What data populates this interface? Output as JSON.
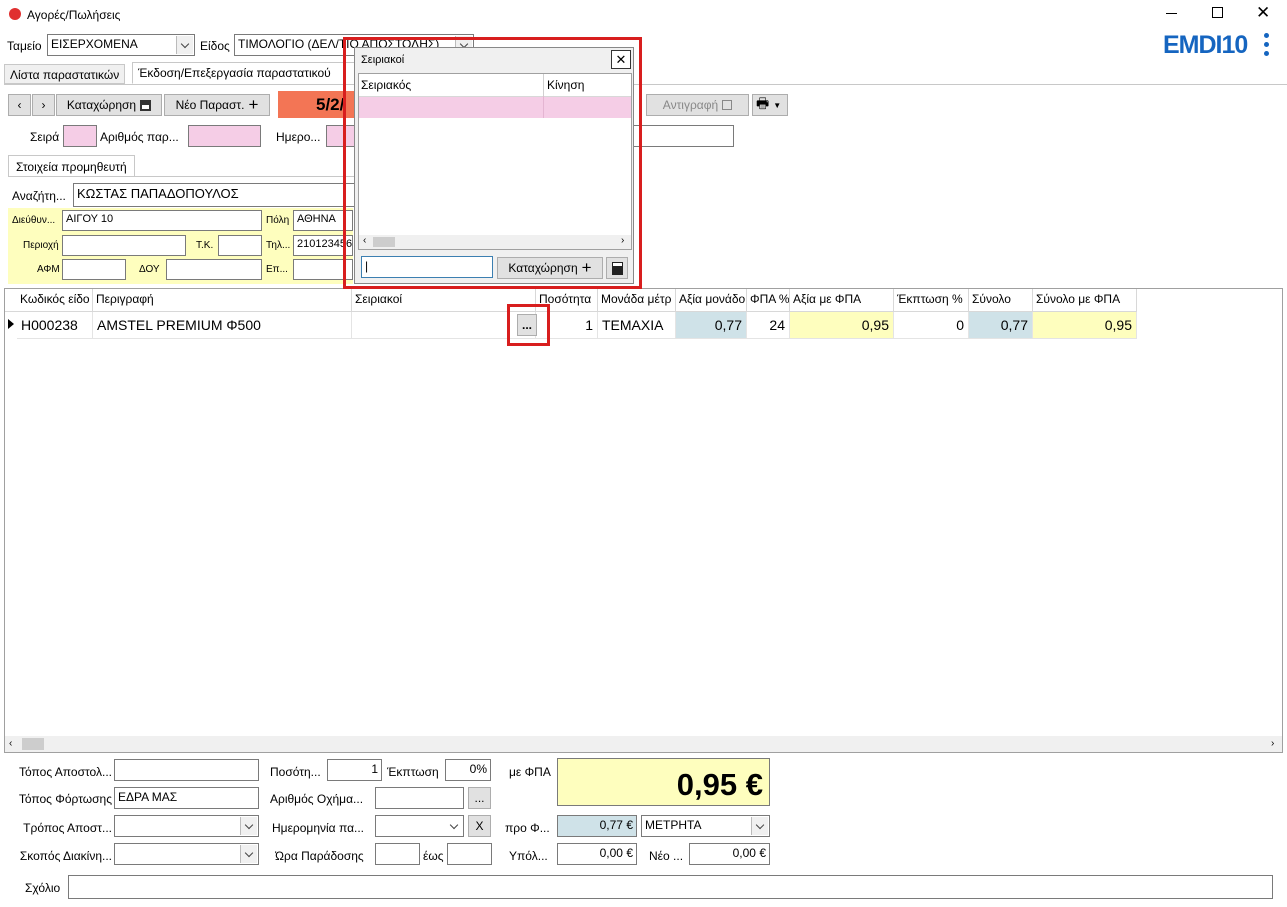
{
  "window": {
    "title": "Αγορές/Πωλήσεις",
    "brand": "EMDI10"
  },
  "top": {
    "tameio_label": "Ταμείο",
    "tameio_value": "ΕΙΣΕΡΧΟΜΕΝΑ",
    "eidos_label": "Είδος",
    "eidos_value": "ΤΙΜΟΛΟΓΙΟ (ΔΕΛ/ΤΙΟ ΑΠΟΣΤΟΛΗΣ)"
  },
  "tabs": [
    "Λίστα παραστατικών",
    "Έκδοση/Επεξεργασία παραστατικού"
  ],
  "toolbar": {
    "save_label": "Καταχώρηση",
    "new_label": "Νέο Παραστ.",
    "date_value": "5/2/",
    "copy_label": "Αντιγραφή"
  },
  "series": {
    "seira_label": "Σειρά",
    "arithmos_label": "Αριθμός παρ...",
    "date_label": "Ημερο..."
  },
  "supplier": {
    "tab_label": "Στοιχεία προμηθευτή",
    "search_label": "Αναζήτη...",
    "search_value": "ΚΩΣΤΑΣ ΠΑΠΑΔΟΠΟΥΛΟΣ",
    "address_label": "Διεύθυν...",
    "address_value": "ΑΙΓΟΥ 10",
    "city_label": "Πόλη",
    "city_value": "ΑΘΗΝΑ",
    "area_label": "Περιοχή",
    "tk_label": "Τ.Κ.",
    "phone_label": "Τηλ...",
    "phone_value": "2101234567",
    "afm_label": "ΑΦΜ",
    "doy_label": "ΔΟΥ",
    "ep_label": "Επ..."
  },
  "grid": {
    "headers": [
      "Κωδικός είδο",
      "Περιγραφή",
      "Σειριακοί",
      "Ποσότητα",
      "Μονάδα μέτρ",
      "Αξία μονάδο",
      "ΦΠΑ %",
      "Αξία με ΦΠΑ",
      "Έκπτωση %",
      "Σύνολο",
      "Σύνολο με ΦΠΑ"
    ],
    "row": {
      "code": "H000238",
      "desc": "AMSTEL PREMIUM Φ500",
      "serial_btn": "...",
      "qty": "1",
      "unit": "ΤΕΜΑΧΙΑ",
      "unit_price": "0,77",
      "vat": "24",
      "price_vat": "0,95",
      "discount": "0",
      "total": "0,77",
      "total_vat": "0,95"
    }
  },
  "popup": {
    "title": "Σειριακοί",
    "col1": "Σειριακός",
    "col2": "Κίνηση",
    "save_label": "Καταχώρηση"
  },
  "bottom": {
    "topos_apost_label": "Τόπος Αποστολ...",
    "topos_fort_label": "Τόπος Φόρτωσης",
    "topos_fort_value": "ΕΔΡΑ ΜΑΣ",
    "tropos_label": "Τρόπος Αποστ...",
    "skopos_label": "Σκοπός Διακίνη...",
    "posotita_label": "Ποσότη...",
    "posotita_value": "1",
    "ekptosi_label": "Έκπτωση",
    "ekptosi_value": "0%",
    "oxima_label": "Αριθμός Οχήμα...",
    "oxima_btn": "...",
    "date_label": "Ημερομηνία πα...",
    "clear_btn": "X",
    "ora_label": "Ώρα Παράδοσης",
    "eos_label": "έως",
    "mefpa_label": "με ΦΠΑ",
    "total_big": "0,95 €",
    "profpa_label": "προ Φ...",
    "profpa_value": "0,77 €",
    "payment_value": "ΜΕΤΡΗΤΑ",
    "ypol_label": "Υπόλ...",
    "ypol_value": "0,00 €",
    "neo_label": "Νέο ...",
    "neo_value": "0,00 €",
    "comment_label": "Σχόλιο"
  }
}
